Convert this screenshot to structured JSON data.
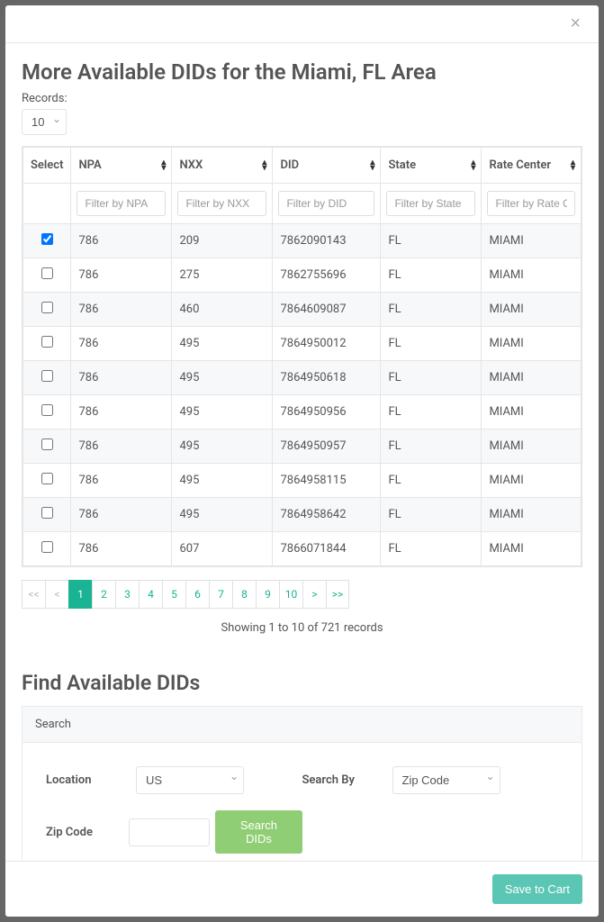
{
  "modal": {
    "close": "×",
    "title": "More Available DIDs for the Miami, FL Area"
  },
  "records": {
    "label": "Records:",
    "value": "10"
  },
  "table": {
    "headers": {
      "select": "Select",
      "npa": "NPA",
      "nxx": "NXX",
      "did": "DID",
      "state": "State",
      "rate_center": "Rate Center"
    },
    "filters": {
      "npa": "Filter by NPA",
      "nxx": "Filter by NXX",
      "did": "Filter by DID",
      "state": "Filter by State",
      "rate_center": "Filter by Rate Center"
    },
    "rows": [
      {
        "checked": true,
        "npa": "786",
        "nxx": "209",
        "did": "7862090143",
        "state": "FL",
        "rate_center": "MIAMI"
      },
      {
        "checked": false,
        "npa": "786",
        "nxx": "275",
        "did": "7862755696",
        "state": "FL",
        "rate_center": "MIAMI"
      },
      {
        "checked": false,
        "npa": "786",
        "nxx": "460",
        "did": "7864609087",
        "state": "FL",
        "rate_center": "MIAMI"
      },
      {
        "checked": false,
        "npa": "786",
        "nxx": "495",
        "did": "7864950012",
        "state": "FL",
        "rate_center": "MIAMI"
      },
      {
        "checked": false,
        "npa": "786",
        "nxx": "495",
        "did": "7864950618",
        "state": "FL",
        "rate_center": "MIAMI"
      },
      {
        "checked": false,
        "npa": "786",
        "nxx": "495",
        "did": "7864950956",
        "state": "FL",
        "rate_center": "MIAMI"
      },
      {
        "checked": false,
        "npa": "786",
        "nxx": "495",
        "did": "7864950957",
        "state": "FL",
        "rate_center": "MIAMI"
      },
      {
        "checked": false,
        "npa": "786",
        "nxx": "495",
        "did": "7864958115",
        "state": "FL",
        "rate_center": "MIAMI"
      },
      {
        "checked": false,
        "npa": "786",
        "nxx": "495",
        "did": "7864958642",
        "state": "FL",
        "rate_center": "MIAMI"
      },
      {
        "checked": false,
        "npa": "786",
        "nxx": "607",
        "did": "7866071844",
        "state": "FL",
        "rate_center": "MIAMI"
      }
    ]
  },
  "pagination": {
    "first": "<<",
    "prev": "<",
    "pages": [
      "1",
      "2",
      "3",
      "4",
      "5",
      "6",
      "7",
      "8",
      "9",
      "10"
    ],
    "next": ">",
    "last": ">>",
    "info": "Showing 1 to 10 of 721 records"
  },
  "find": {
    "title": "Find Available DIDs",
    "panel_head": "Search",
    "location_label": "Location",
    "location_value": "US",
    "search_by_label": "Search By",
    "search_by_value": "Zip Code",
    "zip_label": "Zip Code",
    "search_btn": "Search DIDs"
  },
  "footer": {
    "save": "Save to Cart"
  }
}
